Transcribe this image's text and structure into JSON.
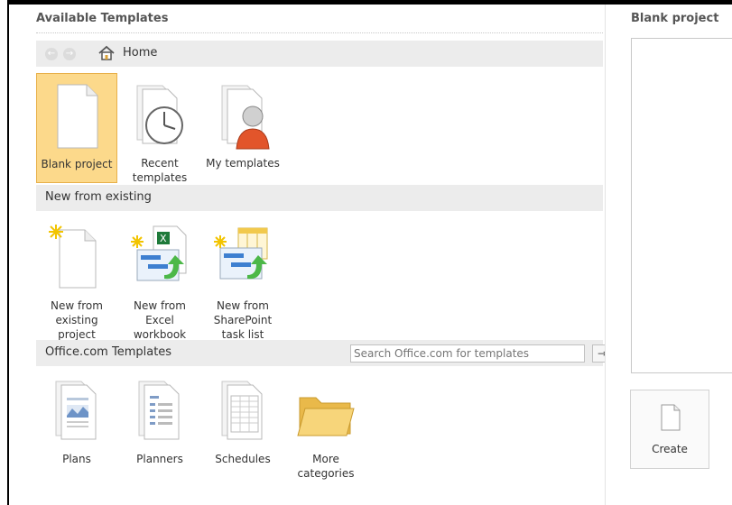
{
  "main": {
    "title": "Available Templates",
    "nav": {
      "back_icon": "back-arrow-icon",
      "forward_icon": "forward-arrow-icon",
      "home_label": "Home"
    },
    "top_tiles": [
      {
        "label": "Blank project",
        "icon": "blank-document-icon",
        "selected": true
      },
      {
        "label": "Recent templates",
        "icon": "clock-document-icon",
        "selected": false
      },
      {
        "label": "My templates",
        "icon": "user-document-icon",
        "selected": false
      }
    ],
    "new_from_existing": {
      "header": "New from existing",
      "tiles": [
        {
          "label": "New from existing project",
          "icon": "new-project-icon"
        },
        {
          "label": "New from Excel workbook",
          "icon": "excel-workbook-icon"
        },
        {
          "label": "New from SharePoint task list",
          "icon": "sharepoint-list-icon"
        }
      ]
    },
    "office_templates": {
      "header": "Office.com Templates",
      "search_placeholder": "Search Office.com for templates",
      "tiles": [
        {
          "label": "Plans",
          "icon": "plans-document-icon"
        },
        {
          "label": "Planners",
          "icon": "planners-document-icon"
        },
        {
          "label": "Schedules",
          "icon": "schedules-document-icon"
        },
        {
          "label": "More categories",
          "icon": "folder-icon"
        }
      ]
    }
  },
  "right_panel": {
    "title": "Blank project",
    "create_label": "Create"
  },
  "colors": {
    "selected_bg": "#fcd98b",
    "selected_border": "#e8b04a",
    "section_bar": "#ececec"
  }
}
